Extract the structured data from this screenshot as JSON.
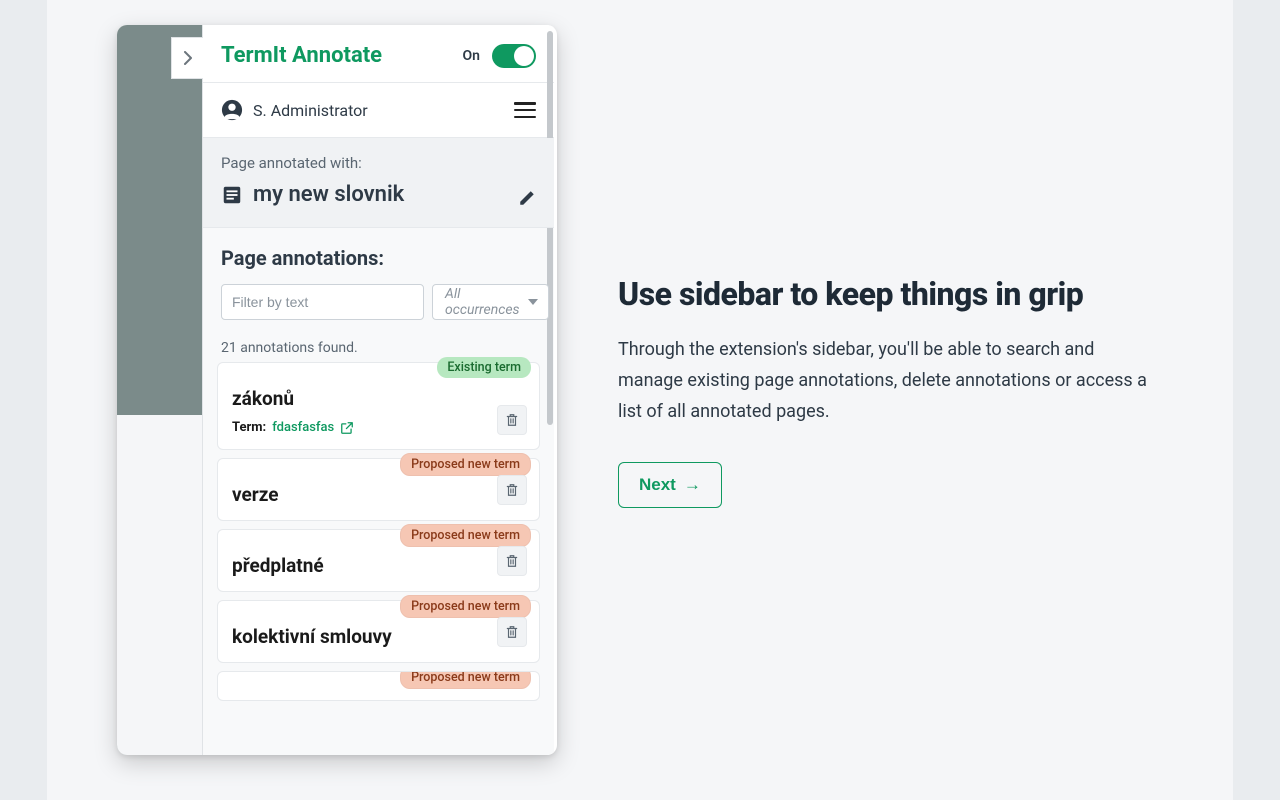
{
  "sidebar": {
    "app_title": "TermIt Annotate",
    "toggle_label": "On",
    "user_name": "S. Administrator",
    "vocab_label": "Page annotated with:",
    "vocab_name": "my new slovnik",
    "section_title": "Page annotations:",
    "filter_placeholder": "Filter by text",
    "occurrence_select": "All occurrences",
    "count_text": "21 annotations found.",
    "badges": {
      "existing": "Existing term",
      "proposed": "Proposed new term"
    },
    "term_label": "Term:",
    "cards": [
      {
        "title": "zákonů",
        "badge": "existing",
        "term_value": "fdasfasfas"
      },
      {
        "title": "verze",
        "badge": "proposed"
      },
      {
        "title": "předplatné",
        "badge": "proposed"
      },
      {
        "title": "kolektivní smlouvy",
        "badge": "proposed"
      },
      {
        "title": "",
        "badge": "proposed"
      }
    ]
  },
  "rhs": {
    "title": "Use sidebar to keep things in grip",
    "body": "Through the extension's sidebar, you'll be able to search and manage existing page annotations, delete annotations or access a list of all annotated pages.",
    "next_label": "Next",
    "next_arrow": "→"
  }
}
